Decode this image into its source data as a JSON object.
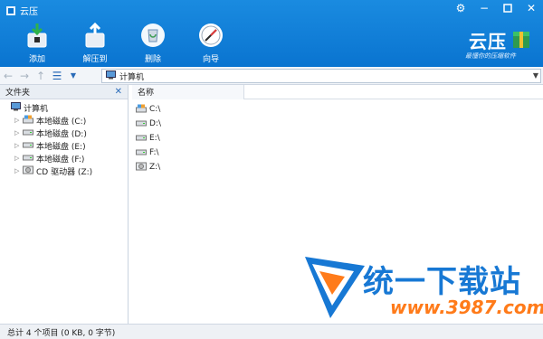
{
  "window": {
    "title": "云压",
    "controls": [
      "gear-icon",
      "minimize-icon",
      "maximize-icon",
      "close-icon"
    ]
  },
  "toolbar": {
    "items": [
      {
        "label": "添加",
        "icon": "add-archive-icon"
      },
      {
        "label": "解压到",
        "icon": "extract-icon"
      },
      {
        "label": "删除",
        "icon": "delete-icon"
      },
      {
        "label": "向导",
        "icon": "wizard-icon"
      }
    ]
  },
  "brand": {
    "name": "云压",
    "slogan": "最懂你的压缩软件"
  },
  "address": {
    "path": "计算机"
  },
  "folder_pane": {
    "title": "文件夹",
    "root": "计算机",
    "drives": [
      "本地磁盘 (C:)",
      "本地磁盘 (D:)",
      "本地磁盘 (E:)",
      "本地磁盘 (F:)",
      "CD 驱动器 (Z:)"
    ]
  },
  "file_pane": {
    "column": "名称",
    "items": [
      "C:\\",
      "D:\\",
      "E:\\",
      "F:\\",
      "Z:\\"
    ]
  },
  "status": {
    "text": "总计 4 个项目 (0 KB, 0 字节)"
  },
  "watermark": {
    "title": "统一下载站",
    "url": "www.3987.com"
  },
  "colors": {
    "accent": "#0a74d0",
    "watermark_blue": "#1778d4",
    "watermark_orange": "#ff7b1a"
  }
}
